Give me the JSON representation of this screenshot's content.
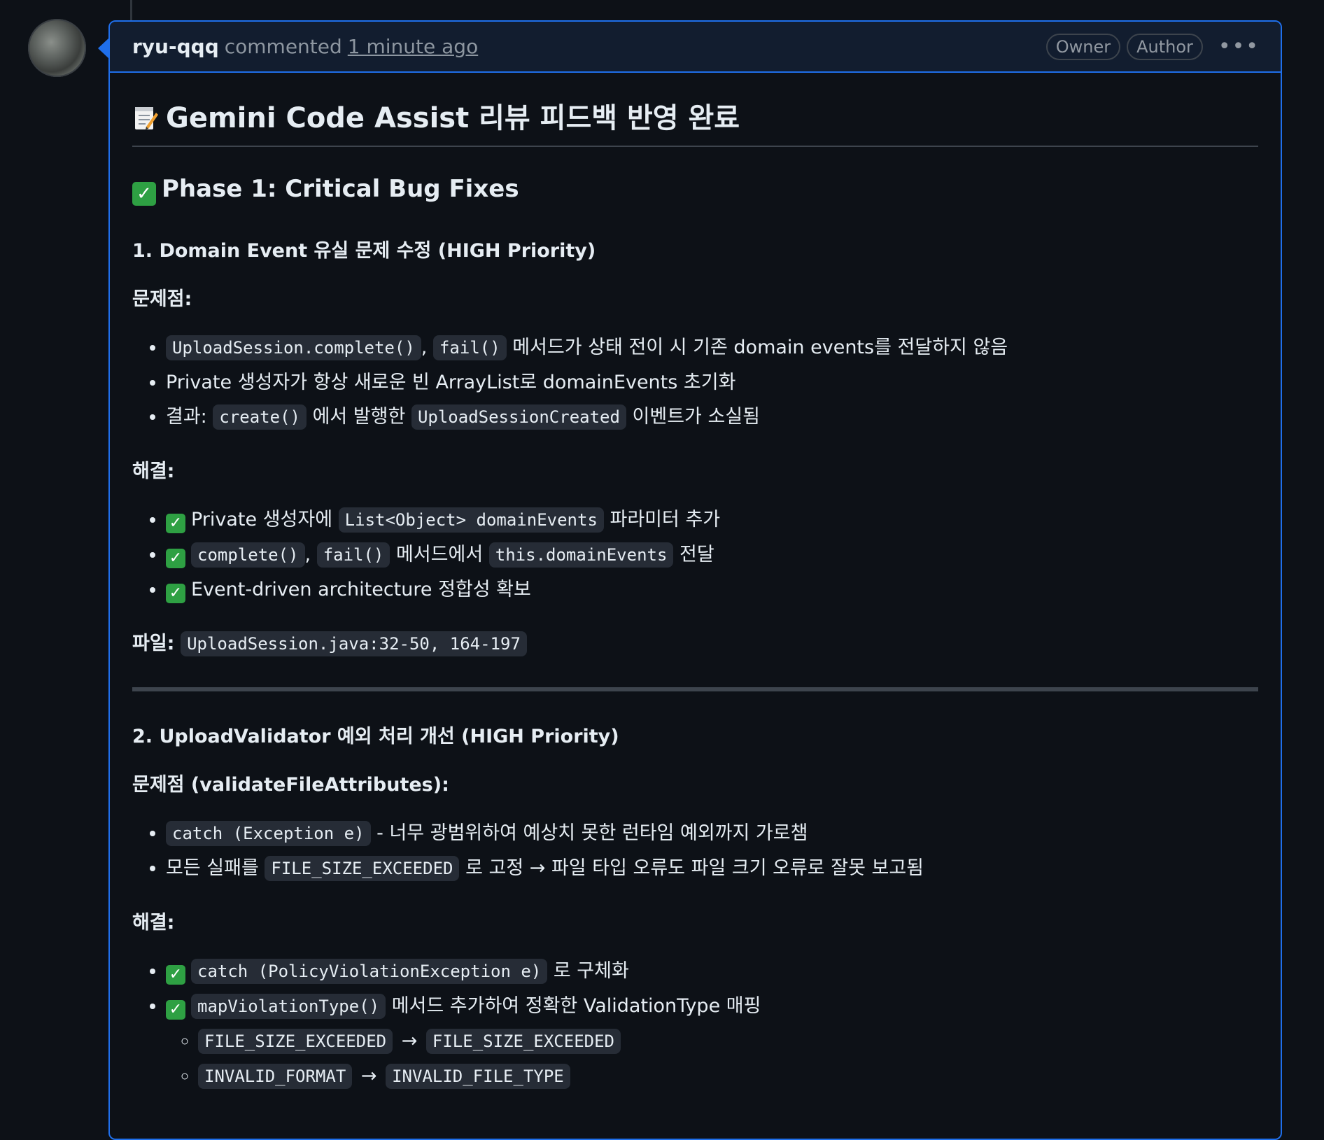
{
  "header": {
    "author": "ryu-qqq",
    "action": "commented",
    "time": "1 minute ago",
    "badges": [
      "Owner",
      "Author"
    ],
    "more_icon": "kebab-horizontal-icon"
  },
  "content": {
    "title": "Gemini Code Assist 리뷰 피드백 반영 완료",
    "phase1_heading": "Phase 1: Critical Bug Fixes",
    "section1": {
      "heading": "1. Domain Event 유실 문제 수정 (HIGH Priority)",
      "problem_label": "문제점:",
      "problems": [
        {
          "code1": "UploadSession.complete()",
          "sep": ",",
          "code2": "fail()",
          "text": "메서드가 상태 전이 시 기존 domain events를 전달하지 않음"
        },
        {
          "text": "Private 생성자가 항상 새로운 빈 ArrayList로 domainEvents 초기화"
        },
        {
          "pre": "결과:",
          "code1": "create()",
          "mid": "에서 발행한",
          "code2": "UploadSessionCreated",
          "text": "이벤트가 소실됨"
        }
      ],
      "solution_label": "해결:",
      "solutions": [
        {
          "pre": "Private 생성자에",
          "code1": "List<Object> domainEvents",
          "text": "파라미터 추가"
        },
        {
          "code1": "complete()",
          "sep": ",",
          "code2": "fail()",
          "mid": "메서드에서",
          "code3": "this.domainEvents",
          "text": "전달"
        },
        {
          "text": "Event-driven architecture 정합성 확보"
        }
      ],
      "file_label": "파일:",
      "file_code": "UploadSession.java:32-50, 164-197"
    },
    "section2": {
      "heading": "2. UploadValidator 예외 처리 개선 (HIGH Priority)",
      "problem_label": "문제점 (validateFileAttributes):",
      "problems": [
        {
          "code1": "catch (Exception e)",
          "text": "- 너무 광범위하여 예상치 못한 런타임 예외까지 가로챔"
        },
        {
          "pre": "모든 실패를",
          "code1": "FILE_SIZE_EXCEEDED",
          "text": "로 고정 → 파일 타입 오류도 파일 크기 오류로 잘못 보고됨"
        }
      ],
      "solution_label": "해결:",
      "solutions": [
        {
          "code1": "catch (PolicyViolationException e)",
          "text": "로 구체화"
        },
        {
          "code1": "mapViolationType()",
          "text": "메서드 추가하여 정확한 ValidationType 매핑"
        }
      ],
      "mappings": [
        {
          "from": "FILE_SIZE_EXCEEDED",
          "arrow": "→",
          "to": "FILE_SIZE_EXCEEDED"
        },
        {
          "from": "INVALID_FORMAT",
          "arrow": "→",
          "to": "INVALID_FILE_TYPE"
        }
      ]
    }
  }
}
